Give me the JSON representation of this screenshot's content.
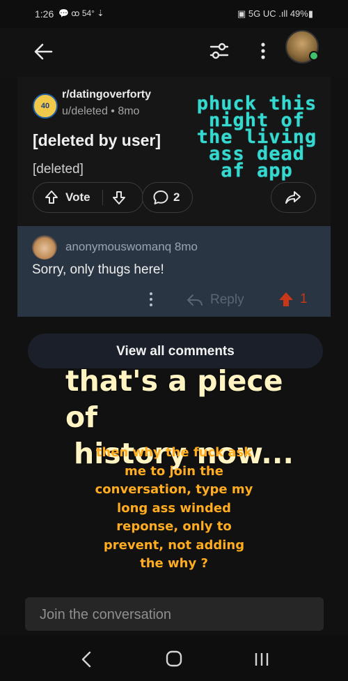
{
  "status_bar": {
    "time": "1:26",
    "left_icons": "💬 ꝏ 54° ⇣",
    "right_text": "▣ 5G UC .ıll 49%▮"
  },
  "app_bar": {
    "back_icon": "back-arrow-icon",
    "filter_icon": "sliders-icon",
    "more_icon": "kebab-menu-icon"
  },
  "post": {
    "subreddit": "r/datingoverforty",
    "subreddit_icon_text": "40",
    "author_meta": "u/deleted • 8mo",
    "title": "[deleted by user]",
    "body": "[deleted]",
    "vote_label": "Vote",
    "comment_count": "2"
  },
  "overlay_1": "phuck this\nnight of\nthe living\nass dead\naf app",
  "comment": {
    "username": "anonymouswomanq",
    "age": "8mo",
    "text": "Sorry, only thugs here!",
    "reply_label": "Reply",
    "score": "1",
    "upvote_color": "#c83818"
  },
  "view_all_label": "View all comments",
  "overlay_2": {
    "line1": "that's a piece of",
    "line2": "history now..."
  },
  "overlay_3": "then why the fuck ask me to join the conversation, type my long ass winded reponse, only to prevent, not adding the why ?",
  "composer": {
    "placeholder": "Join the conversation"
  },
  "colors": {
    "teal_overlay": "#36d9cf",
    "orange_overlay": "#ffac20",
    "comment_bg": "#2a3543"
  }
}
